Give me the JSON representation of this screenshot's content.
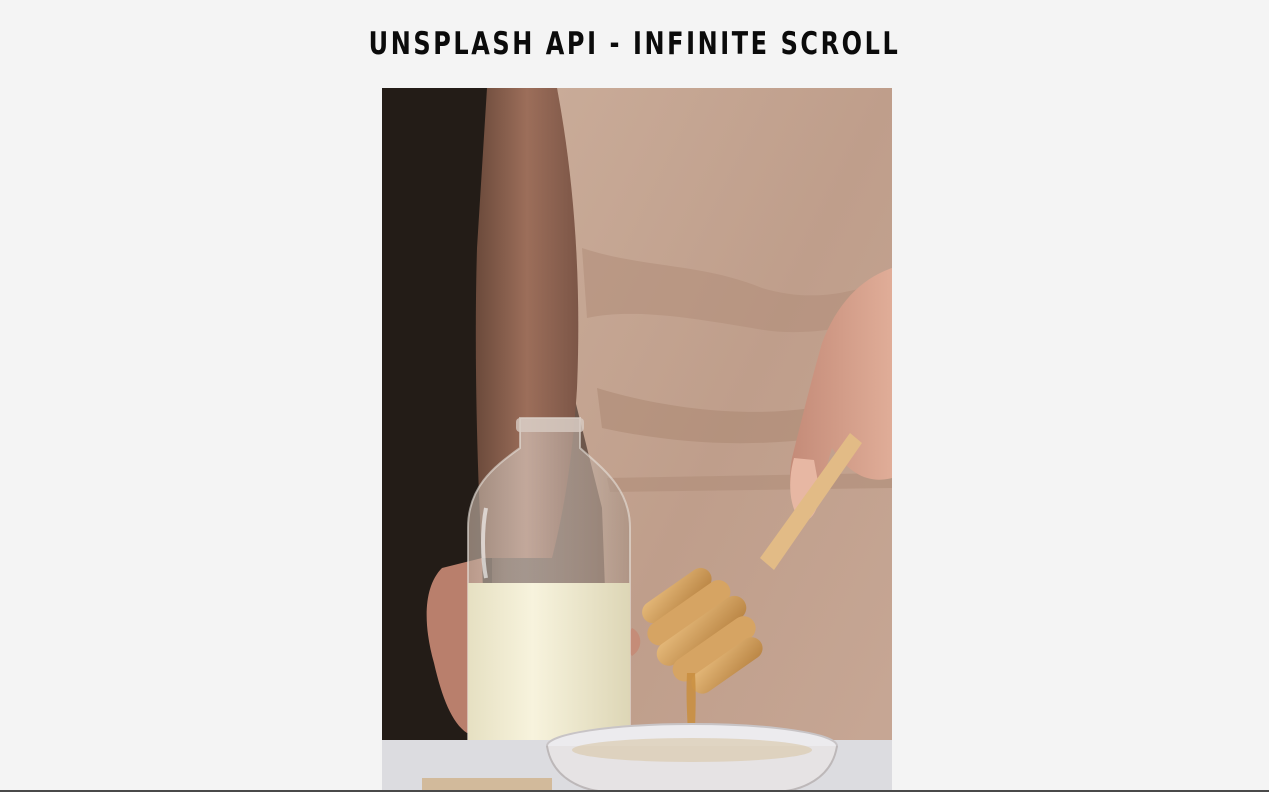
{
  "header": {
    "title": "UNSPLASH API - INFINITE SCROLL"
  },
  "image_container": {
    "photos": [
      {
        "icon": "photo-honey-dipper-milk-bottle"
      }
    ]
  },
  "colors": {
    "background": "#f4f4f4",
    "title": "#0b0b0b"
  }
}
